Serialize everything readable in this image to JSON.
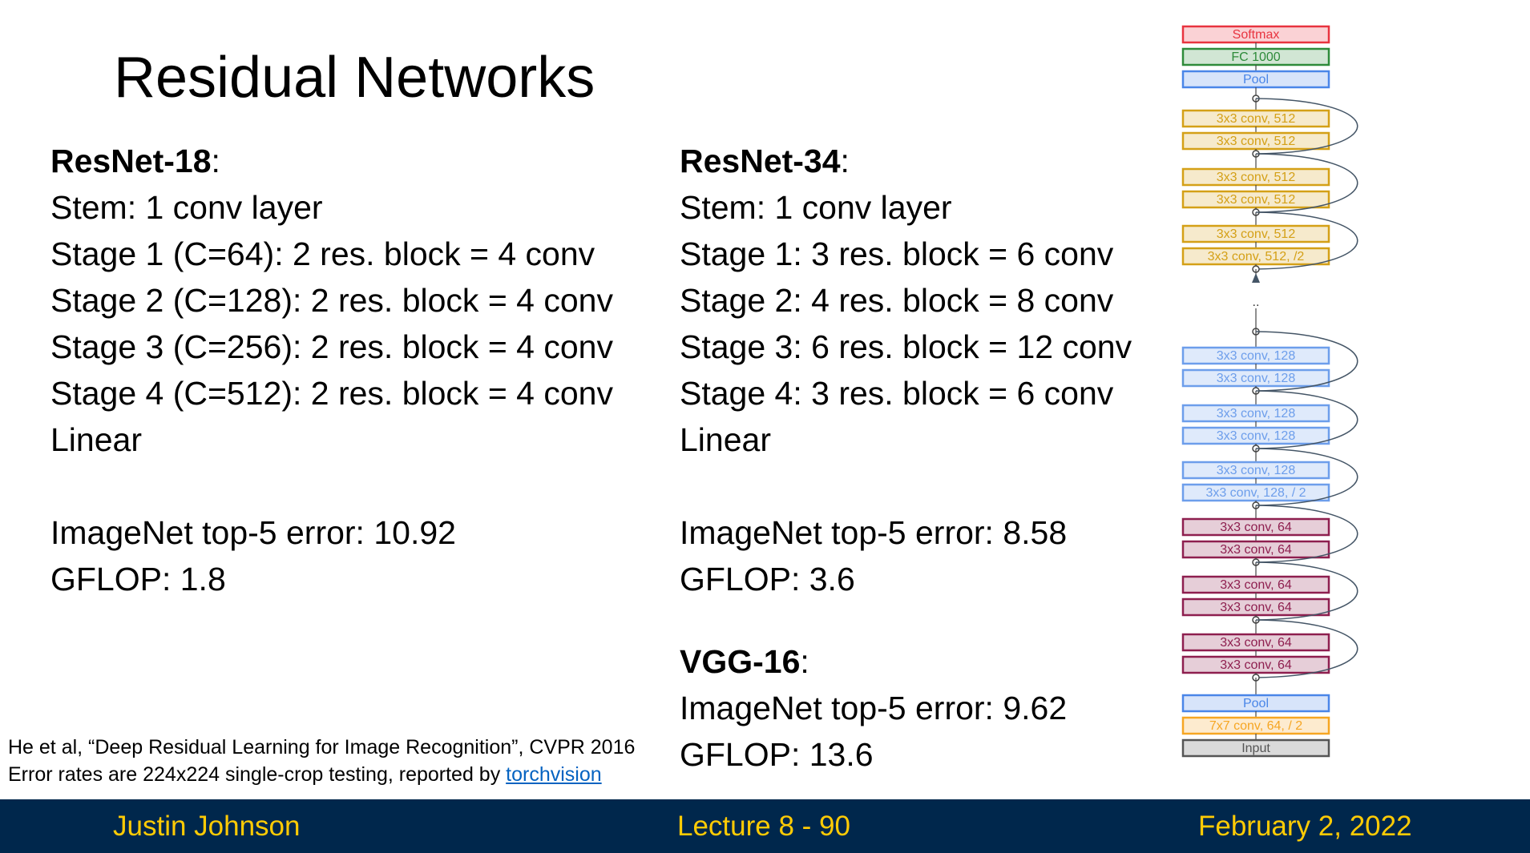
{
  "slide": {
    "title": "Residual Networks"
  },
  "resnet18": {
    "name": "ResNet-18",
    "colon": ":",
    "lines": [
      "Stem: 1 conv layer",
      "Stage 1 (C=64): 2 res. block = 4 conv",
      "Stage 2 (C=128): 2 res. block = 4 conv",
      "Stage 3 (C=256): 2 res. block = 4 conv",
      "Stage 4 (C=512): 2 res. block = 4 conv",
      "Linear"
    ],
    "error": "ImageNet top-5 error: 10.92",
    "gflop": "GFLOP: 1.8"
  },
  "resnet34": {
    "name": "ResNet-34",
    "colon": ":",
    "lines": [
      "Stem: 1 conv layer",
      "Stage 1: 3 res. block = 6 conv",
      "Stage 2: 4 res. block = 8 conv",
      "Stage 3: 6 res. block = 12 conv",
      "Stage 4: 3 res. block = 6 conv",
      "Linear"
    ],
    "error": "ImageNet top-5 error: 8.58",
    "gflop": "GFLOP: 3.6"
  },
  "vgg16": {
    "name": "VGG-16",
    "colon": ":",
    "error": "ImageNet top-5 error: 9.62",
    "gflop": "GFLOP: 13.6"
  },
  "citation": {
    "line1": "He et al, “Deep Residual Learning for Image Recognition”, CVPR 2016",
    "line2_prefix": "Error rates are 224x224 single-crop testing, reported by ",
    "link": "torchvision"
  },
  "footer": {
    "author": "Justin Johnson",
    "lecture": "Lecture 8 - 90",
    "date": "February 2, 2022"
  },
  "diagram": {
    "colors": {
      "softmax": "#e8343f",
      "fc": "#2e8b3a",
      "pool": "#4a86e8",
      "conv512": "#d4a017",
      "conv128": "#6d9eeb",
      "conv64": "#8e1f4f",
      "stem": "#f6a623",
      "input": "#555555"
    },
    "layers_top": [
      {
        "label": "Softmax",
        "kind": "softmax"
      },
      {
        "label": "FC 1000",
        "kind": "fc"
      },
      {
        "label": "Pool",
        "kind": "pool"
      },
      {
        "label": "3x3 conv, 512",
        "kind": "conv512"
      },
      {
        "label": "3x3 conv, 512",
        "kind": "conv512"
      },
      {
        "label": "3x3 conv, 512",
        "kind": "conv512"
      },
      {
        "label": "3x3 conv, 512",
        "kind": "conv512"
      },
      {
        "label": "3x3 conv, 512",
        "kind": "conv512"
      },
      {
        "label": "3x3 conv, 512, /2",
        "kind": "conv512"
      }
    ],
    "ellipsis": "..",
    "layers_bottom": [
      {
        "label": "3x3 conv, 128",
        "kind": "conv128"
      },
      {
        "label": "3x3 conv, 128",
        "kind": "conv128"
      },
      {
        "label": "3x3 conv, 128",
        "kind": "conv128"
      },
      {
        "label": "3x3 conv, 128",
        "kind": "conv128"
      },
      {
        "label": "3x3 conv, 128",
        "kind": "conv128"
      },
      {
        "label": "3x3 conv, 128, / 2",
        "kind": "conv128"
      },
      {
        "label": "3x3 conv, 64",
        "kind": "conv64"
      },
      {
        "label": "3x3 conv, 64",
        "kind": "conv64"
      },
      {
        "label": "3x3 conv, 64",
        "kind": "conv64"
      },
      {
        "label": "3x3 conv, 64",
        "kind": "conv64"
      },
      {
        "label": "3x3 conv, 64",
        "kind": "conv64"
      },
      {
        "label": "3x3 conv, 64",
        "kind": "conv64"
      },
      {
        "label": "Pool",
        "kind": "pool"
      },
      {
        "label": "7x7 conv, 64, / 2",
        "kind": "stem"
      },
      {
        "label": "Input",
        "kind": "input"
      }
    ]
  }
}
